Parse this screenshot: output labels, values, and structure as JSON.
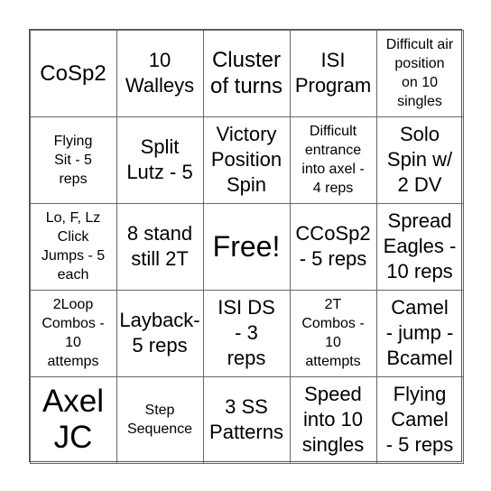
{
  "cells": [
    {
      "text": "CoSp2",
      "size": "l"
    },
    {
      "text": "10\nWalleys",
      "size": "m"
    },
    {
      "text": "Cluster\nof turns",
      "size": "l"
    },
    {
      "text": "ISI\nProgram",
      "size": "m"
    },
    {
      "text": "Difficult air\nposition\non 10\nsingles",
      "size": "s"
    },
    {
      "text": "Flying\nSit - 5\nreps",
      "size": "s"
    },
    {
      "text": "Split\nLutz - 5",
      "size": "m"
    },
    {
      "text": "Victory\nPosition\nSpin",
      "size": "m"
    },
    {
      "text": "Difficult\nentrance\ninto axel -\n4 reps",
      "size": "s"
    },
    {
      "text": "Solo\nSpin w/\n2 DV",
      "size": "m"
    },
    {
      "text": "Lo, F, Lz\nClick\nJumps - 5\neach",
      "size": "s"
    },
    {
      "text": "8 stand\nstill 2T",
      "size": "m"
    },
    {
      "text": "Free!",
      "size": "xl"
    },
    {
      "text": "CCoSp2\n- 5 reps",
      "size": "m"
    },
    {
      "text": "Spread\nEagles -\n10 reps",
      "size": "m"
    },
    {
      "text": "2Loop\nCombos -\n10\nattemps",
      "size": "s"
    },
    {
      "text": "Layback-\n5 reps",
      "size": "m"
    },
    {
      "text": "ISI DS\n- 3\nreps",
      "size": "m"
    },
    {
      "text": "2T\nCombos -\n10\nattempts",
      "size": "s"
    },
    {
      "text": "Camel\n- jump -\nBcamel",
      "size": "m"
    },
    {
      "text": "Axel\nJC",
      "size": "xxl"
    },
    {
      "text": "Step\nSequence",
      "size": "s"
    },
    {
      "text": "3 SS\nPatterns",
      "size": "m"
    },
    {
      "text": "Speed\ninto 10\nsingles",
      "size": "m"
    },
    {
      "text": "Flying\nCamel\n- 5 reps",
      "size": "m"
    }
  ]
}
